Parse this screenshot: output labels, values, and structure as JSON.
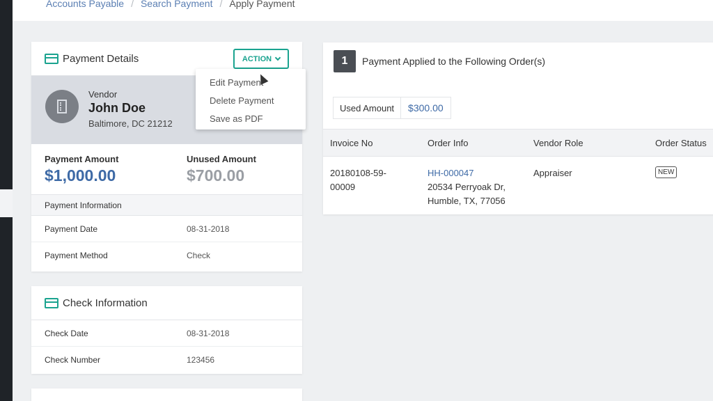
{
  "breadcrumb": {
    "items": [
      "Accounts Payable",
      "Search Payment"
    ],
    "current": "Apply Payment",
    "separator": "/"
  },
  "payment_details": {
    "title": "Payment Details",
    "action_label": "ACTION",
    "action_menu": [
      "Edit Payment",
      "Delete Payment",
      "Save as PDF"
    ],
    "vendor": {
      "label": "Vendor",
      "name": "John Doe",
      "address": "Baltimore, DC 21212"
    },
    "payment_amount_label": "Payment Amount",
    "payment_amount": "$1,000.00",
    "unused_amount_label": "Unused Amount",
    "unused_amount": "$700.00",
    "info_section_label": "Payment Information",
    "rows": [
      {
        "label": "Payment Date",
        "value": "08-31-2018"
      },
      {
        "label": "Payment Method",
        "value": "Check"
      }
    ]
  },
  "check_information": {
    "title": "Check Information",
    "rows": [
      {
        "label": "Check Date",
        "value": "08-31-2018"
      },
      {
        "label": "Check Number",
        "value": "123456"
      }
    ]
  },
  "applied": {
    "step": "1",
    "title": "Payment Applied to the Following Order(s)",
    "used_amount_label": "Used Amount",
    "used_amount": "$300.00",
    "columns": [
      "Invoice No",
      "Order Info",
      "Vendor Role",
      "Order Status"
    ],
    "rows": [
      {
        "invoice_line1": "20180108-59-",
        "invoice_line2": "00009",
        "order_id": "HH-000047",
        "order_addr1": "20534 Perryoak Dr,",
        "order_addr2": "Humble, TX, 77056",
        "vendor_role": "Appraiser",
        "status": "NEW"
      }
    ]
  },
  "colors": {
    "accent": "#1aa38f",
    "link": "#3e6aa6",
    "sidebar": "#1f2328"
  }
}
